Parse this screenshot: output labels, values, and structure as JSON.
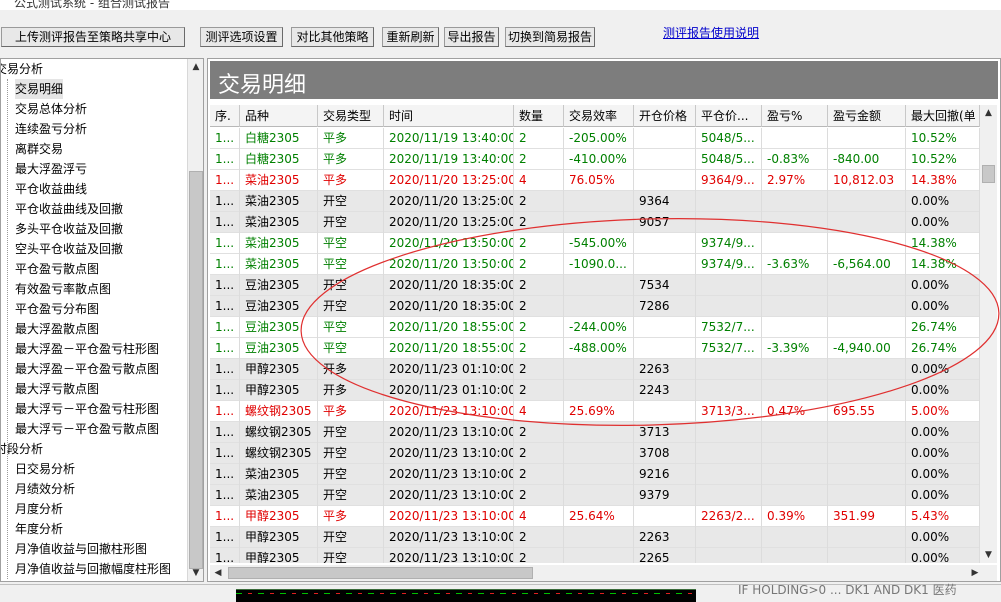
{
  "window": {
    "title": "公式测试系统 - 组合测试报告"
  },
  "toolbar": {
    "upload_label": "上传测评报告至策略共享中心",
    "options_label": "测评选项设置",
    "compare_label": "对比其他策略",
    "refresh_label": "重新刷新",
    "export_label": "导出报告",
    "switch_label": "切换到简易报告",
    "help_link": "测评报告使用说明"
  },
  "tree": {
    "items": [
      {
        "label": "交易分析",
        "level": 0
      },
      {
        "label": "交易明细",
        "level": 1,
        "selected": true
      },
      {
        "label": "交易总体分析",
        "level": 1
      },
      {
        "label": "连续盈亏分析",
        "level": 1
      },
      {
        "label": "离群交易",
        "level": 1
      },
      {
        "label": "最大浮盈浮亏",
        "level": 1
      },
      {
        "label": "平仓收益曲线",
        "level": 1
      },
      {
        "label": "平仓收益曲线及回撤",
        "level": 1
      },
      {
        "label": "多头平仓收益及回撤",
        "level": 1
      },
      {
        "label": "空头平仓收益及回撤",
        "level": 1
      },
      {
        "label": "平仓盈亏散点图",
        "level": 1
      },
      {
        "label": "有效盈亏率散点图",
        "level": 1
      },
      {
        "label": "平仓盈亏分布图",
        "level": 1
      },
      {
        "label": "最大浮盈散点图",
        "level": 1
      },
      {
        "label": "最大浮盈－平仓盈亏柱形图",
        "level": 1
      },
      {
        "label": "最大浮盈－平仓盈亏散点图",
        "level": 1
      },
      {
        "label": "最大浮亏散点图",
        "level": 1
      },
      {
        "label": "最大浮亏－平仓盈亏柱形图",
        "level": 1
      },
      {
        "label": "最大浮亏－平仓盈亏散点图",
        "level": 1
      },
      {
        "label": "时段分析",
        "level": 0
      },
      {
        "label": "日交易分析",
        "level": 1
      },
      {
        "label": "月绩效分析",
        "level": 1
      },
      {
        "label": "月度分析",
        "level": 1
      },
      {
        "label": "年度分析",
        "level": 1
      },
      {
        "label": "月净值收益与回撤柱形图",
        "level": 1
      },
      {
        "label": "月净值收益与回撤幅度柱形图",
        "level": 1
      }
    ]
  },
  "main": {
    "title": "交易明细"
  },
  "table": {
    "columns": [
      "序.",
      "品种",
      "交易类型",
      "时间",
      "数量",
      "交易效率",
      "开仓价格",
      "平仓价...",
      "盈亏%",
      "盈亏金额",
      "最大回撤(单"
    ],
    "rows": [
      {
        "cells": [
          "1...",
          "白糖2305",
          "平多",
          "2020/11/19 13:40:00",
          "2",
          "-205.00%",
          "",
          "5048/5...",
          "",
          "",
          "10.52%"
        ],
        "color": "green",
        "shade": false
      },
      {
        "cells": [
          "1...",
          "白糖2305",
          "平多",
          "2020/11/19 13:40:00",
          "2",
          "-410.00%",
          "",
          "5048/5...",
          "-0.83%",
          "-840.00",
          "10.52%"
        ],
        "color": "green",
        "shade": false
      },
      {
        "cells": [
          "1...",
          "菜油2305",
          "平多",
          "2020/11/20 13:25:00",
          "4",
          "76.05%",
          "",
          "9364/9...",
          "2.97%",
          "10,812.03",
          "14.38%"
        ],
        "color": "red",
        "shade": false
      },
      {
        "cells": [
          "1...",
          "菜油2305",
          "开空",
          "2020/11/20 13:25:00",
          "2",
          "",
          "9364",
          "",
          "",
          "",
          "0.00%"
        ],
        "color": "black",
        "shade": true
      },
      {
        "cells": [
          "1...",
          "菜油2305",
          "开空",
          "2020/11/20 13:25:00",
          "2",
          "",
          "9057",
          "",
          "",
          "",
          "0.00%"
        ],
        "color": "black",
        "shade": true
      },
      {
        "cells": [
          "1...",
          "菜油2305",
          "平空",
          "2020/11/20 13:50:00",
          "2",
          "-545.00%",
          "",
          "9374/9...",
          "",
          "",
          "14.38%"
        ],
        "color": "green",
        "shade": false
      },
      {
        "cells": [
          "1...",
          "菜油2305",
          "平空",
          "2020/11/20 13:50:00",
          "2",
          "-1090.0...",
          "",
          "9374/9...",
          "-3.63%",
          "-6,564.00",
          "14.38%"
        ],
        "color": "green",
        "shade": false
      },
      {
        "cells": [
          "1...",
          "豆油2305",
          "开空",
          "2020/11/20 18:35:00",
          "2",
          "",
          "7534",
          "",
          "",
          "",
          "0.00%"
        ],
        "color": "black",
        "shade": true
      },
      {
        "cells": [
          "1...",
          "豆油2305",
          "开空",
          "2020/11/20 18:35:00",
          "2",
          "",
          "7286",
          "",
          "",
          "",
          "0.00%"
        ],
        "color": "black",
        "shade": true
      },
      {
        "cells": [
          "1...",
          "豆油2305",
          "平空",
          "2020/11/20 18:55:00",
          "2",
          "-244.00%",
          "",
          "7532/7...",
          "",
          "",
          "26.74%"
        ],
        "color": "green",
        "shade": false
      },
      {
        "cells": [
          "1...",
          "豆油2305",
          "平空",
          "2020/11/20 18:55:00",
          "2",
          "-488.00%",
          "",
          "7532/7...",
          "-3.39%",
          "-4,940.00",
          "26.74%"
        ],
        "color": "green",
        "shade": false
      },
      {
        "cells": [
          "1...",
          "甲醇2305",
          "开多",
          "2020/11/23 01:10:00",
          "2",
          "",
          "2263",
          "",
          "",
          "",
          "0.00%"
        ],
        "color": "black",
        "shade": true
      },
      {
        "cells": [
          "1...",
          "甲醇2305",
          "开多",
          "2020/11/23 01:10:00",
          "2",
          "",
          "2243",
          "",
          "",
          "",
          "0.00%"
        ],
        "color": "black",
        "shade": true
      },
      {
        "cells": [
          "1...",
          "螺纹钢2305",
          "平多",
          "2020/11/23 13:10:00",
          "4",
          "25.69%",
          "",
          "3713/3...",
          "0.47%",
          "695.55",
          "5.00%"
        ],
        "color": "red",
        "shade": false
      },
      {
        "cells": [
          "1...",
          "螺纹钢2305",
          "开空",
          "2020/11/23 13:10:00",
          "2",
          "",
          "3713",
          "",
          "",
          "",
          "0.00%"
        ],
        "color": "black",
        "shade": true
      },
      {
        "cells": [
          "1...",
          "螺纹钢2305",
          "开空",
          "2020/11/23 13:10:00",
          "2",
          "",
          "3708",
          "",
          "",
          "",
          "0.00%"
        ],
        "color": "black",
        "shade": true
      },
      {
        "cells": [
          "1...",
          "菜油2305",
          "开空",
          "2020/11/23 13:10:00",
          "2",
          "",
          "9216",
          "",
          "",
          "",
          "0.00%"
        ],
        "color": "black",
        "shade": true
      },
      {
        "cells": [
          "1...",
          "菜油2305",
          "开空",
          "2020/11/23 13:10:00",
          "2",
          "",
          "9379",
          "",
          "",
          "",
          "0.00%"
        ],
        "color": "black",
        "shade": true
      },
      {
        "cells": [
          "1...",
          "甲醇2305",
          "平多",
          "2020/11/23 13:10:00",
          "4",
          "25.64%",
          "",
          "2263/2...",
          "0.39%",
          "351.99",
          "5.43%"
        ],
        "color": "red",
        "shade": false
      },
      {
        "cells": [
          "1...",
          "甲醇2305",
          "开空",
          "2020/11/23 13:10:00",
          "2",
          "",
          "2263",
          "",
          "",
          "",
          "0.00%"
        ],
        "color": "black",
        "shade": true
      },
      {
        "cells": [
          "1...",
          "甲醇2305",
          "开空",
          "2020/11/23 13:10:00",
          "2",
          "",
          "2265",
          "",
          "",
          "",
          "0.00%"
        ],
        "color": "black",
        "shade": true
      }
    ]
  },
  "colors": {
    "green": "#008000",
    "red": "#e00000",
    "black": "#000000",
    "shade": "#e8e8e8",
    "annotation": "#e03030"
  },
  "status": {
    "note": "IF HOLDING>0 ... DK1 AND DK1 医药"
  }
}
